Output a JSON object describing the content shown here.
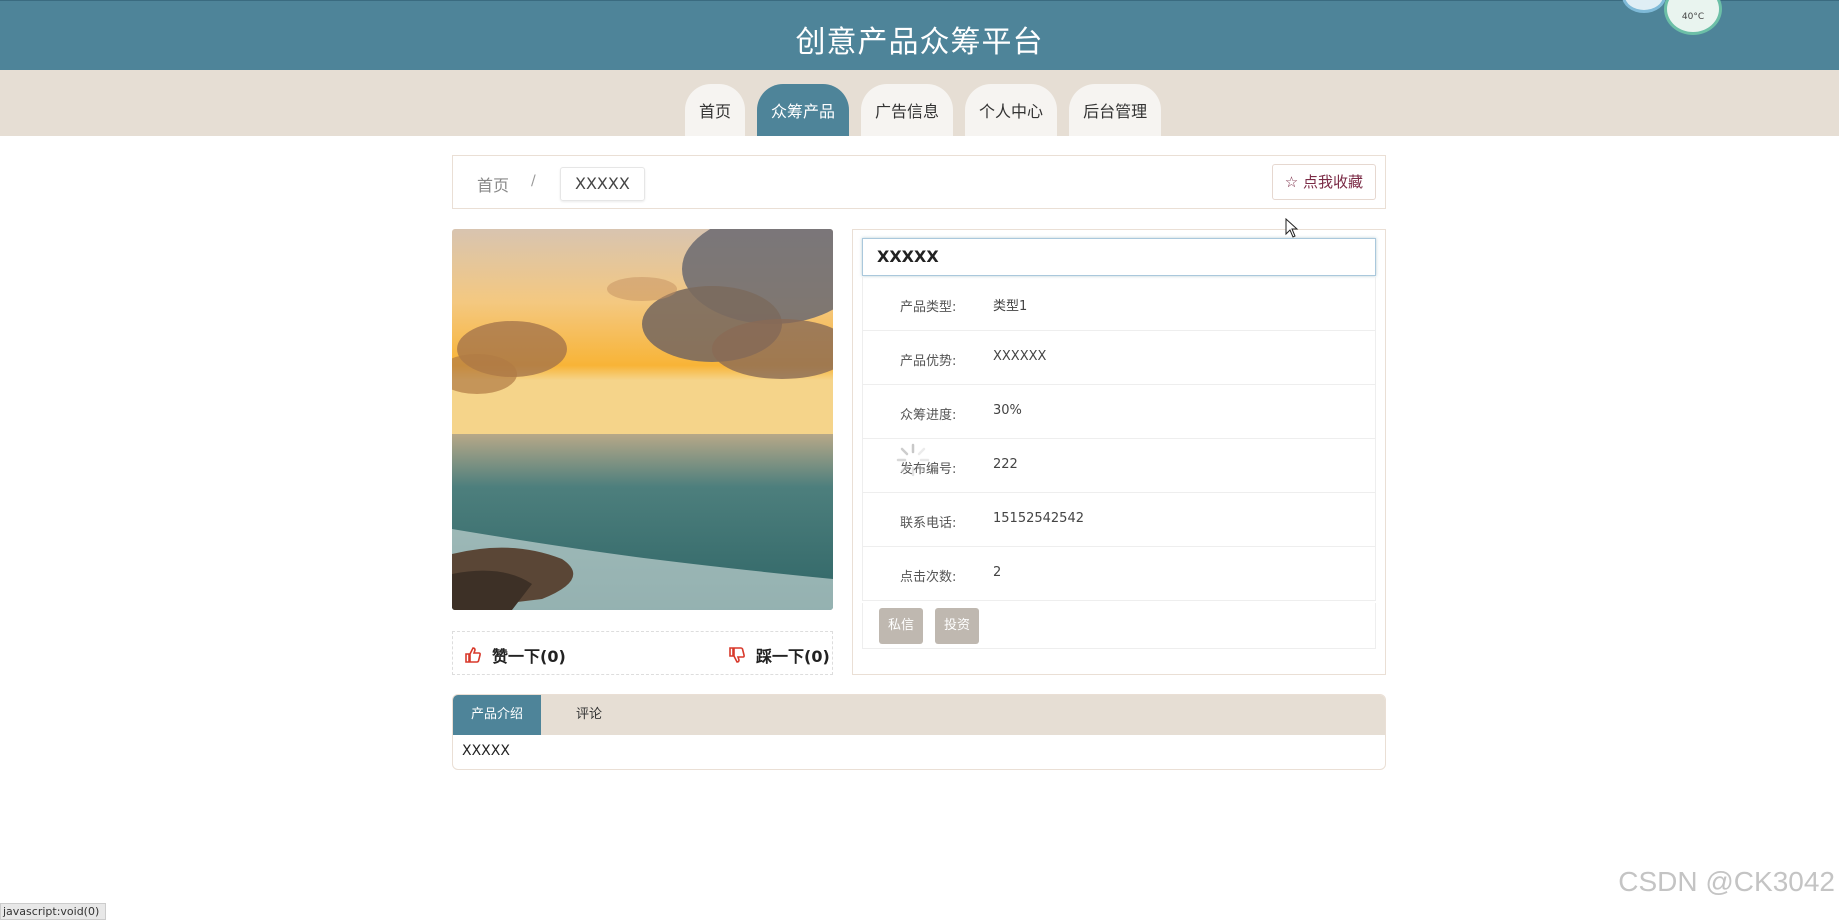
{
  "header": {
    "title": "创意产品众筹平台",
    "weather_temp": "40°C"
  },
  "nav": {
    "items": [
      {
        "label": "首页",
        "active": false
      },
      {
        "label": "众筹产品",
        "active": true
      },
      {
        "label": "广告信息",
        "active": false
      },
      {
        "label": "个人中心",
        "active": false
      },
      {
        "label": "后台管理",
        "active": false
      }
    ]
  },
  "breadcrumb": {
    "home": "首页",
    "separator": "/",
    "current": "XXXXX"
  },
  "favorite_button": {
    "icon": "star-outline-icon",
    "label": "点我收藏"
  },
  "product": {
    "title": "XXXXX",
    "image_alt": "sunset over sea",
    "fields": [
      {
        "label": "产品类型:",
        "value": "类型1"
      },
      {
        "label": "产品优势:",
        "value": "XXXXXX"
      },
      {
        "label": "众筹进度:",
        "value": "30%"
      },
      {
        "label": "发布编号:",
        "value": "222"
      },
      {
        "label": "联系电话:",
        "value": "15152542542"
      },
      {
        "label": "点击次数:",
        "value": "2"
      }
    ],
    "actions": {
      "message": "私信",
      "invest": "投资"
    }
  },
  "votes": {
    "like": "赞一下(0)",
    "dislike": "踩一下(0)"
  },
  "tabs": {
    "items": [
      {
        "label": "产品介绍",
        "active": true
      },
      {
        "label": "评论",
        "active": false
      }
    ],
    "content": "XXXXX"
  },
  "status_bar": {
    "link": "javascript:void(0)"
  },
  "watermark": "CSDN @CK3042",
  "colors": {
    "primary": "#4e8499",
    "band": "#e6ded4",
    "button_gray": "#bfb8b0",
    "accent_red": "#d8392b"
  }
}
